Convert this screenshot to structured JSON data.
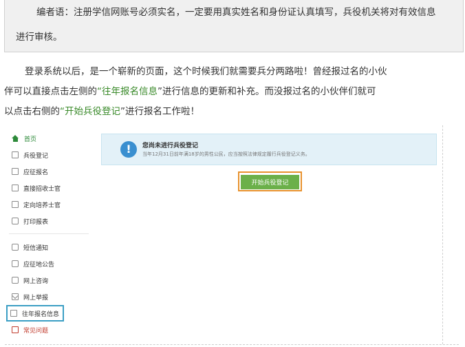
{
  "editor_note": {
    "line1": "编者语：注册学信网账号必须实名，一定要用真实姓名和身份证认真填写，兵役机关将对有效信息",
    "line2": "进行审核。"
  },
  "paragraph": {
    "l1": "登录系统以后，是一个崭新的页面，这个时候我们就需要兵分两路啦！曾经报过名的小伙",
    "l2_before": "伴可以直接点击左侧的",
    "l2_hl": "“往年报名信息",
    "l2_after": "”进行信息的更新和补充。而没报过名的小伙伴们就可",
    "l3_before": "以点击右侧的",
    "l3_hl": "“开始兵役登记",
    "l3_after": "”进行报名工作啦！",
    "highlight_color": "#3a8a2a"
  },
  "sidebar": {
    "items": [
      {
        "label": "首页",
        "icon": "home-icon"
      },
      {
        "label": "兵役登记",
        "icon": "document-icon"
      },
      {
        "label": "应征报名",
        "icon": "form-icon"
      },
      {
        "label": "直接招收士官",
        "icon": "id-card-icon"
      },
      {
        "label": "定向培养士官",
        "icon": "id-card-icon"
      },
      {
        "label": "打印报表",
        "icon": "printer-icon"
      },
      {
        "label": "短信通知",
        "icon": "message-icon"
      },
      {
        "label": "应征地公告",
        "icon": "message-icon"
      },
      {
        "label": "网上咨询",
        "icon": "message-icon"
      },
      {
        "label": "网上举报",
        "icon": "mail-icon"
      },
      {
        "label": "往年报名信息",
        "icon": "history-icon"
      },
      {
        "label": "常见问题",
        "icon": "question-icon"
      }
    ]
  },
  "notice": {
    "title": "您尚未进行兵役登记",
    "desc": "当年12月31日前年满18岁的男性公民，应当按照法律规定履行兵役登记义务。",
    "icon": "exclamation-icon"
  },
  "start_button": {
    "label": "开始兵役登记"
  },
  "colors": {
    "accent_green": "#6bb04a",
    "highlight_orange": "#e8912c",
    "highlight_blue": "#3a9ec4",
    "notice_bg": "#e3f1f8"
  }
}
